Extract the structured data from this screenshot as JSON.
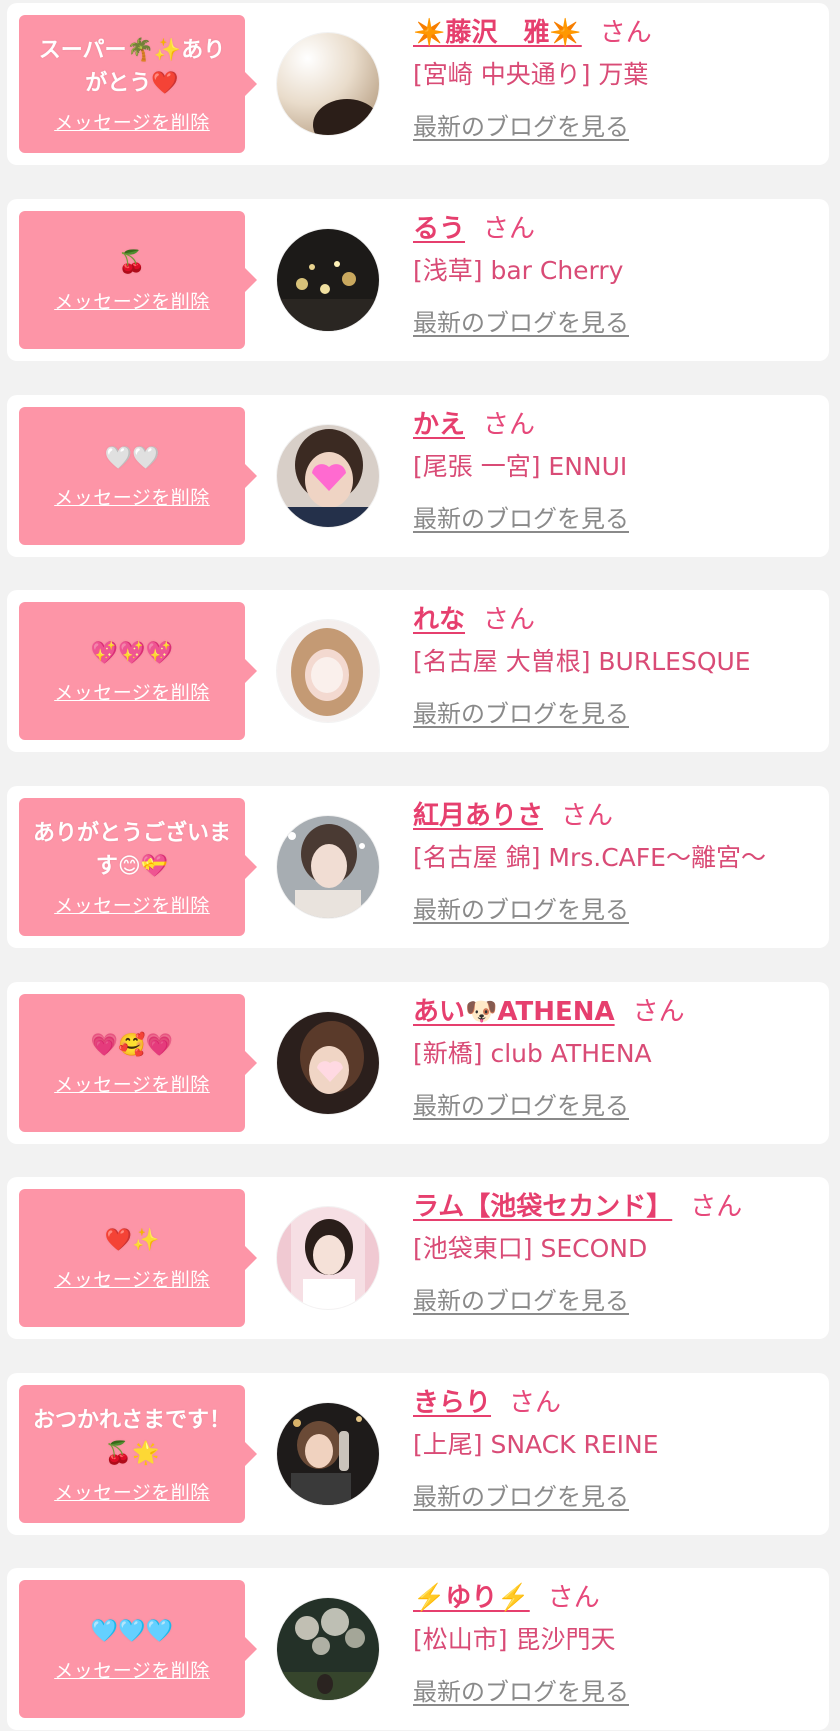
{
  "delete_label": "メッセージを削除",
  "san_label": "さん",
  "blog_label": "最新のブログを見る",
  "colors": {
    "bubble": "#fd95a7",
    "accent": "#e63f6e",
    "link_gray": "#8a8a8a",
    "background": "#f2f2f2"
  },
  "items": [
    {
      "message": "スーパー🌴✨ありがとう❤️",
      "name": "✴️藤沢　雅✴️",
      "shop": "[宮崎 中央通り] 万葉",
      "avatar_icon": "profile-photo-icon"
    },
    {
      "message": "🍒",
      "name": "るう",
      "shop": "[浅草] bar Cherry",
      "avatar_icon": "profile-photo-icon"
    },
    {
      "message": "🤍🤍",
      "name": "かえ",
      "shop": "[尾張 一宮] ENNUI",
      "avatar_icon": "profile-photo-icon"
    },
    {
      "message": "💖💖💖",
      "name": "れな",
      "shop": "[名古屋 大曽根] BURLESQUE",
      "avatar_icon": "profile-photo-icon"
    },
    {
      "message": "ありがとうございます😊💝",
      "name": "紅月ありさ",
      "shop": "[名古屋 錦] Mrs.CAFE〜離宮〜",
      "avatar_icon": "profile-photo-icon"
    },
    {
      "message": "💗🥰💗",
      "name": "あい🐶ATHENA",
      "shop": "[新橋] club ATHENA",
      "avatar_icon": "profile-photo-icon"
    },
    {
      "message": "❤️✨",
      "name": "ラム【池袋セカンド】",
      "shop": "[池袋東口] SECOND",
      "avatar_icon": "profile-photo-icon"
    },
    {
      "message": "おつかれさまです！🍒🌟",
      "name": "きらり",
      "shop": "[上尾] SNACK REINE",
      "avatar_icon": "profile-photo-icon"
    },
    {
      "message": "🩵🩵🩵",
      "name": "⚡️ゆり⚡️",
      "shop": "[松山市] 毘沙門天",
      "avatar_icon": "profile-photo-icon"
    }
  ]
}
